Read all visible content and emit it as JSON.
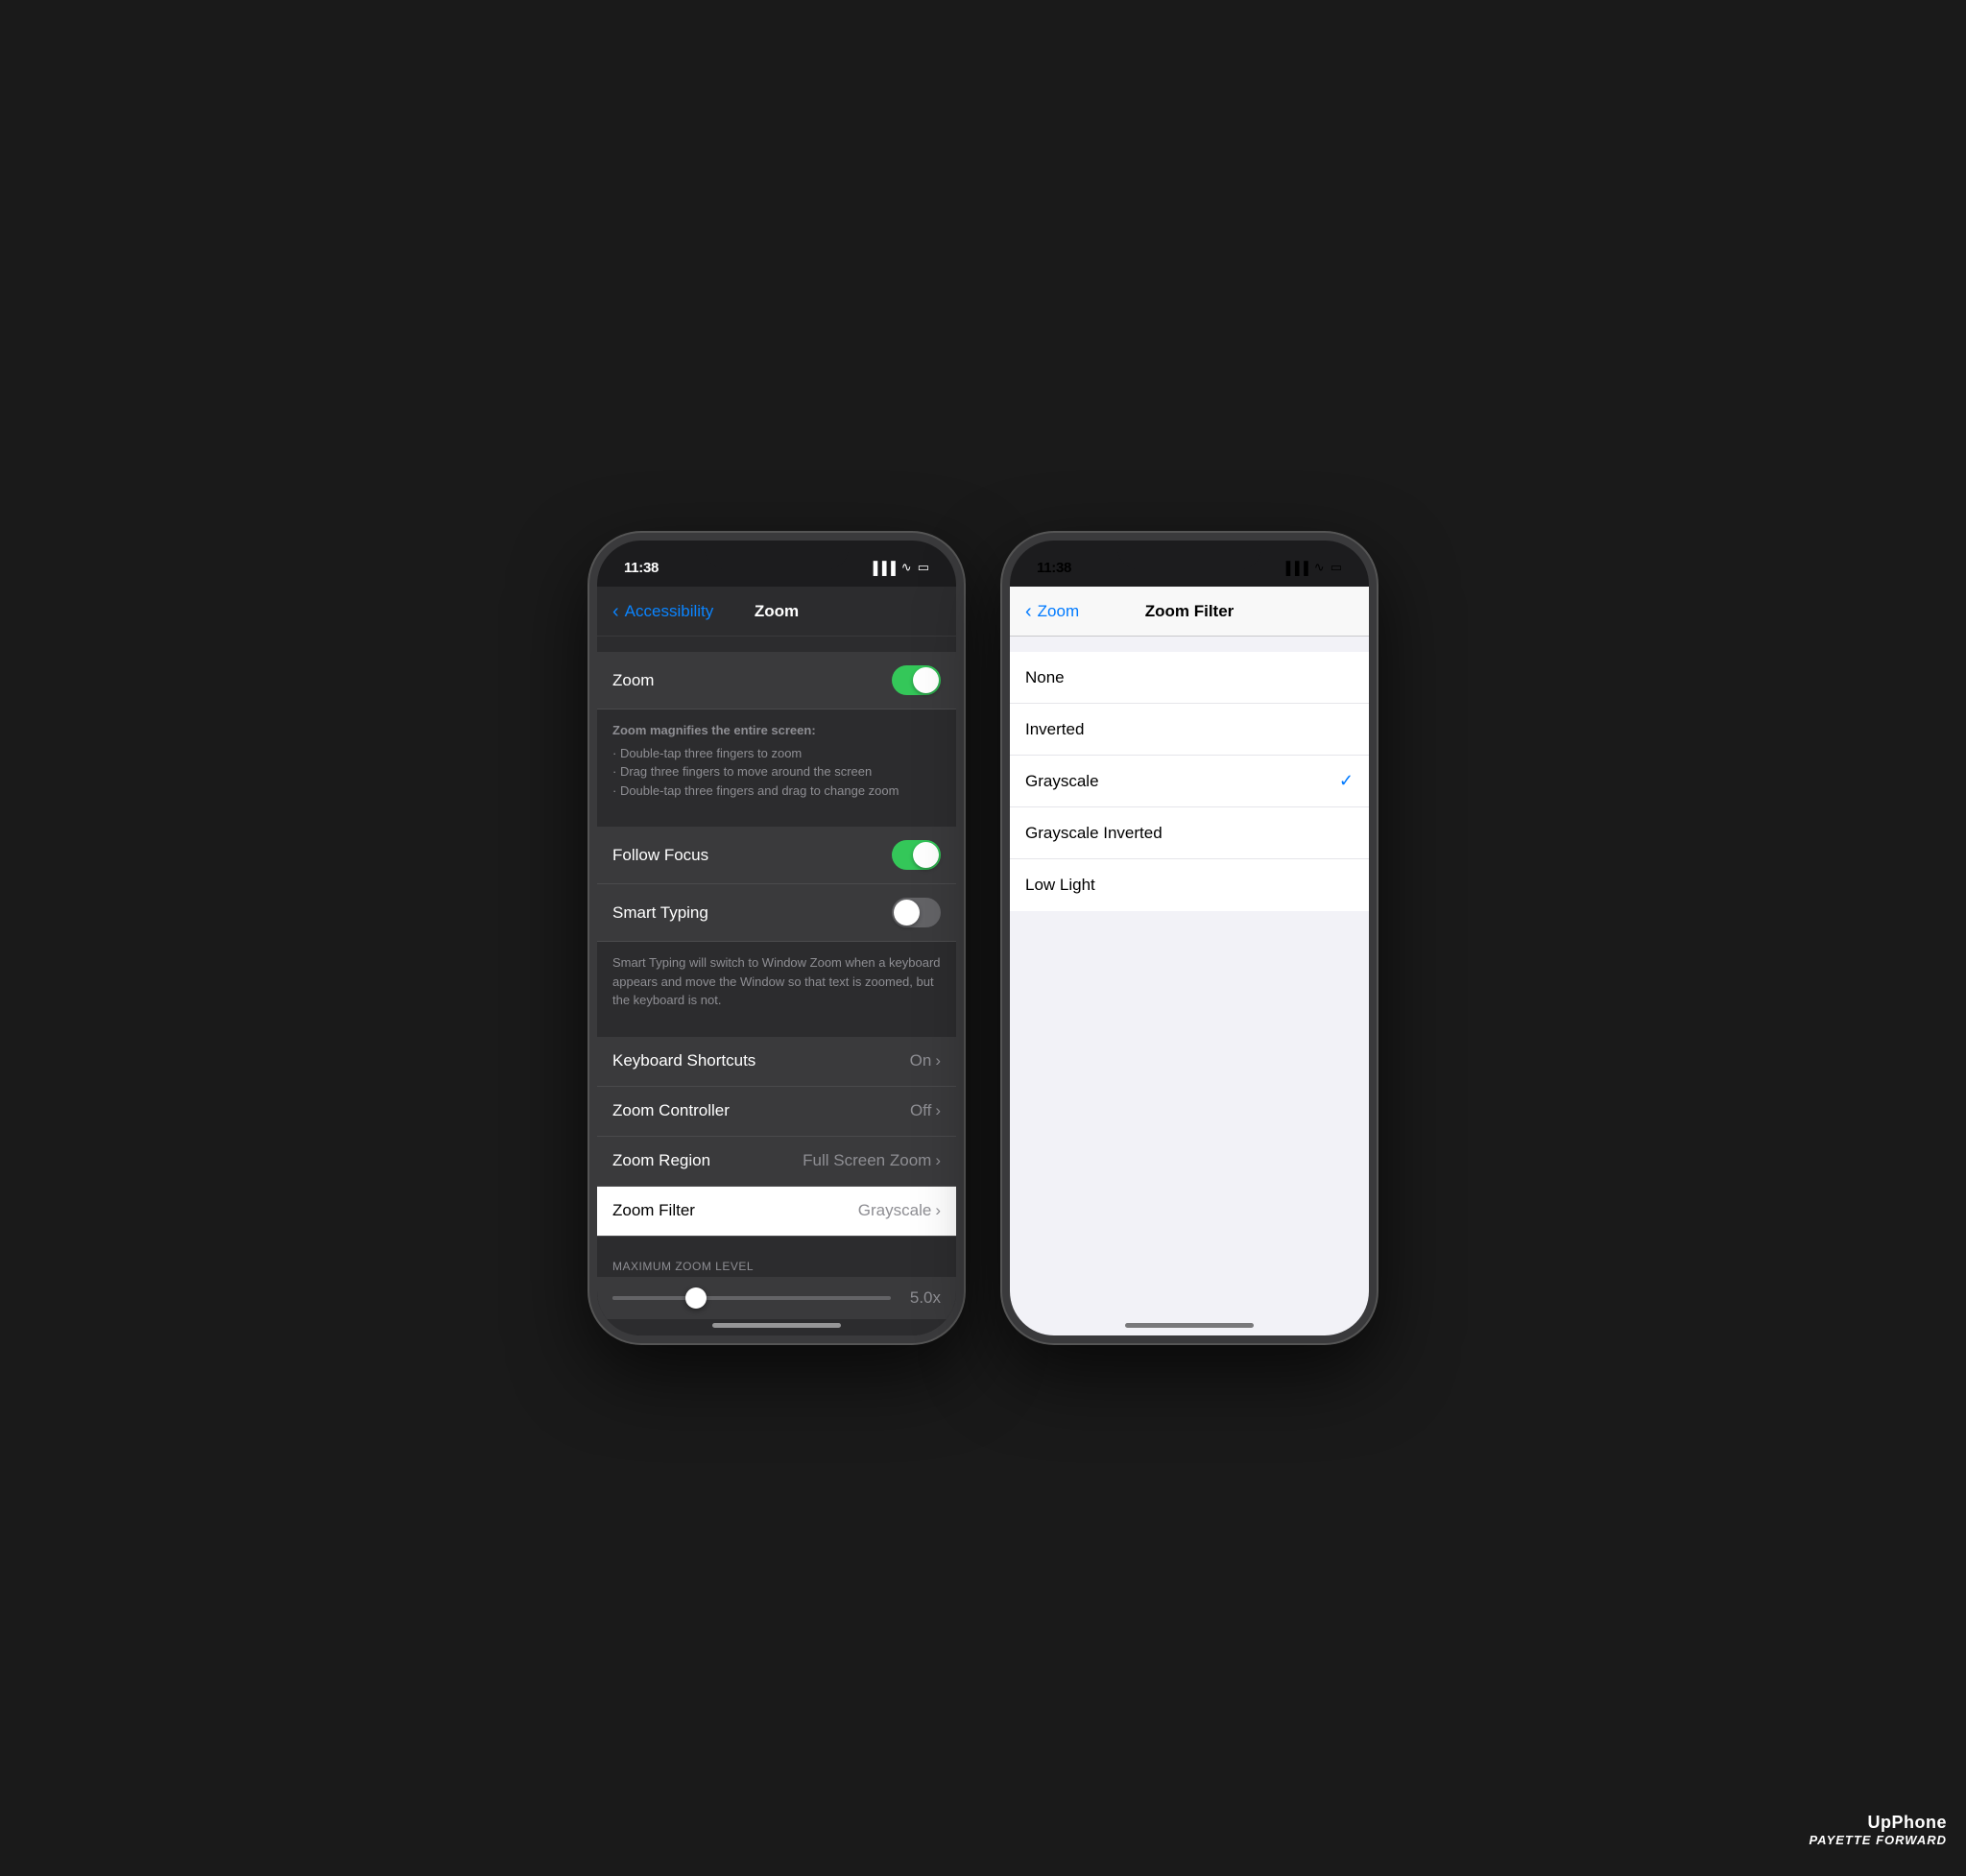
{
  "watermark": {
    "upphone": "UpPhone",
    "payette": "PAYETTE FORWARD"
  },
  "left_phone": {
    "status": {
      "time": "11:38",
      "signal": "▐▐▐▐",
      "wifi": "WiFi",
      "battery": "Batt"
    },
    "nav": {
      "back_label": "Accessibility",
      "title": "Zoom"
    },
    "sections": [
      {
        "rows": [
          {
            "label": "Zoom",
            "type": "toggle",
            "toggle_state": "on"
          }
        ],
        "description": {
          "title": "Zoom magnifies the entire screen:",
          "items": [
            "Double-tap three fingers to zoom",
            "Drag three fingers to move around the screen",
            "Double-tap three fingers and drag to change zoom"
          ]
        }
      },
      {
        "rows": [
          {
            "label": "Follow Focus",
            "type": "toggle",
            "toggle_state": "on"
          },
          {
            "label": "Smart Typing",
            "type": "toggle",
            "toggle_state": "off"
          }
        ],
        "description": {
          "text": "Smart Typing will switch to Window Zoom when a keyboard appears and move the Window so that text is zoomed, but the keyboard is not."
        }
      },
      {
        "rows": [
          {
            "label": "Keyboard Shortcuts",
            "type": "value",
            "value": "On"
          },
          {
            "label": "Zoom Controller",
            "type": "value",
            "value": "Off"
          },
          {
            "label": "Zoom Region",
            "type": "value",
            "value": "Full Screen Zoom"
          },
          {
            "label": "Zoom Filter",
            "type": "value",
            "value": "Grayscale",
            "highlighted": true
          }
        ]
      },
      {
        "header": "MAXIMUM ZOOM LEVEL",
        "slider": {
          "value": "5.0x",
          "fill_percent": 30
        }
      }
    ]
  },
  "right_phone": {
    "status": {
      "time": "11:38",
      "signal": "▐▐▐▐",
      "wifi": "WiFi",
      "battery": "Batt"
    },
    "nav": {
      "back_label": "Zoom",
      "title": "Zoom Filter"
    },
    "filters": [
      {
        "label": "None",
        "selected": false
      },
      {
        "label": "Inverted",
        "selected": false
      },
      {
        "label": "Grayscale",
        "selected": true
      },
      {
        "label": "Grayscale Inverted",
        "selected": false
      },
      {
        "label": "Low Light",
        "selected": false
      }
    ]
  }
}
